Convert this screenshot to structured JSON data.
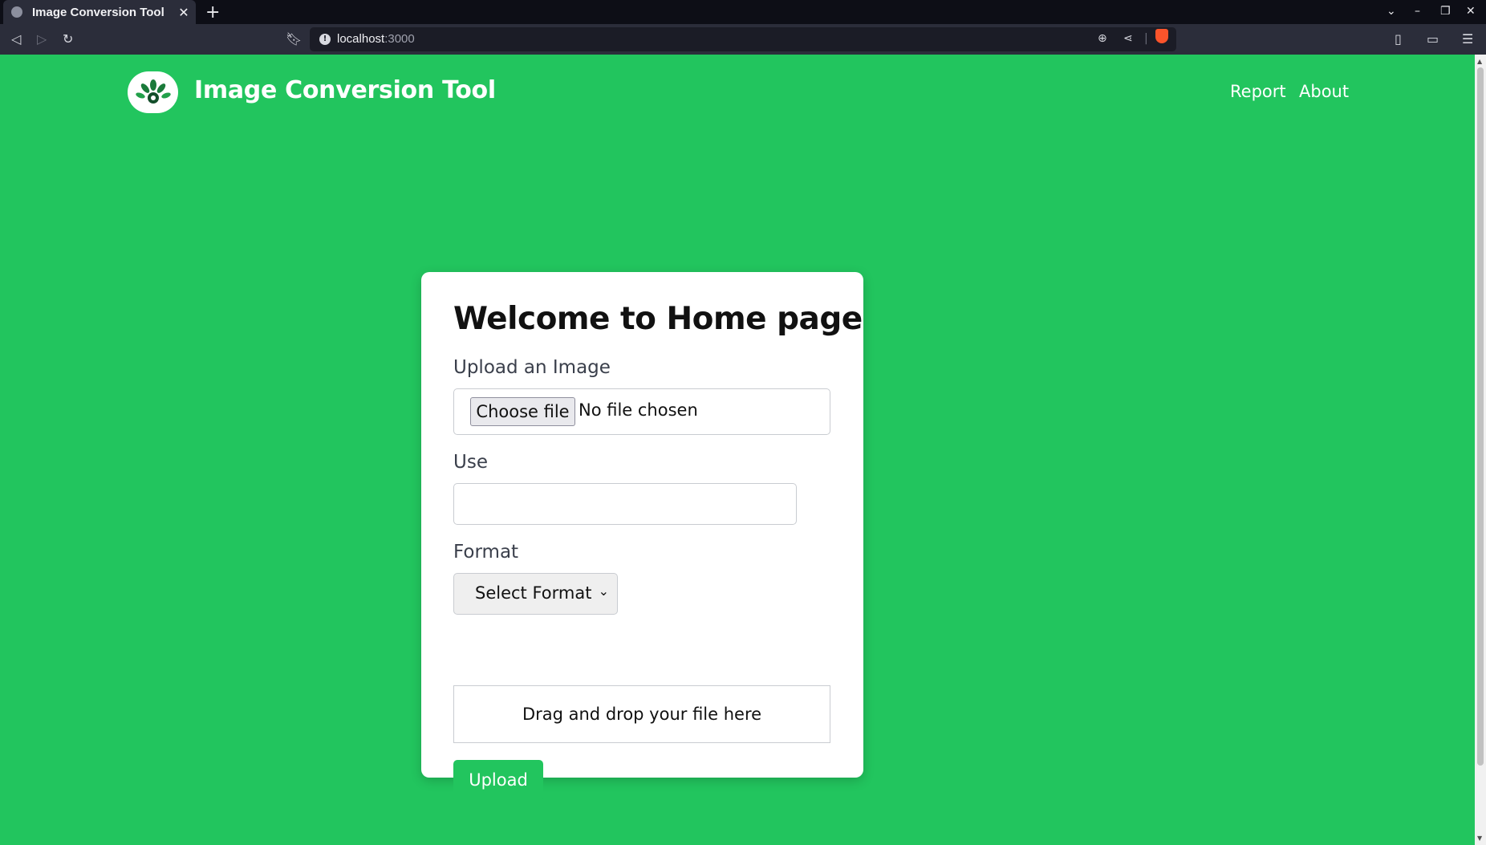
{
  "browser": {
    "tab_title": "Image Conversion Tool",
    "tab_close": "✕",
    "new_tab": "+",
    "url_host": "localhost",
    "url_port": ":3000"
  },
  "header": {
    "brand": "Image Conversion Tool",
    "nav": [
      "Report",
      "About"
    ]
  },
  "card": {
    "heading": "Welcome to Home page",
    "upload_label": "Upload an Image",
    "choose_file_button": "Choose file",
    "file_status": "No file chosen",
    "use_label": "Use",
    "use_value": "",
    "format_label": "Format",
    "format_selected": "Select Format",
    "dropzone_text": "Drag and drop your file here",
    "upload_button": "Upload"
  },
  "colors": {
    "page_background": "#22c55e",
    "button_background": "#22c55e",
    "card_background": "#ffffff"
  }
}
